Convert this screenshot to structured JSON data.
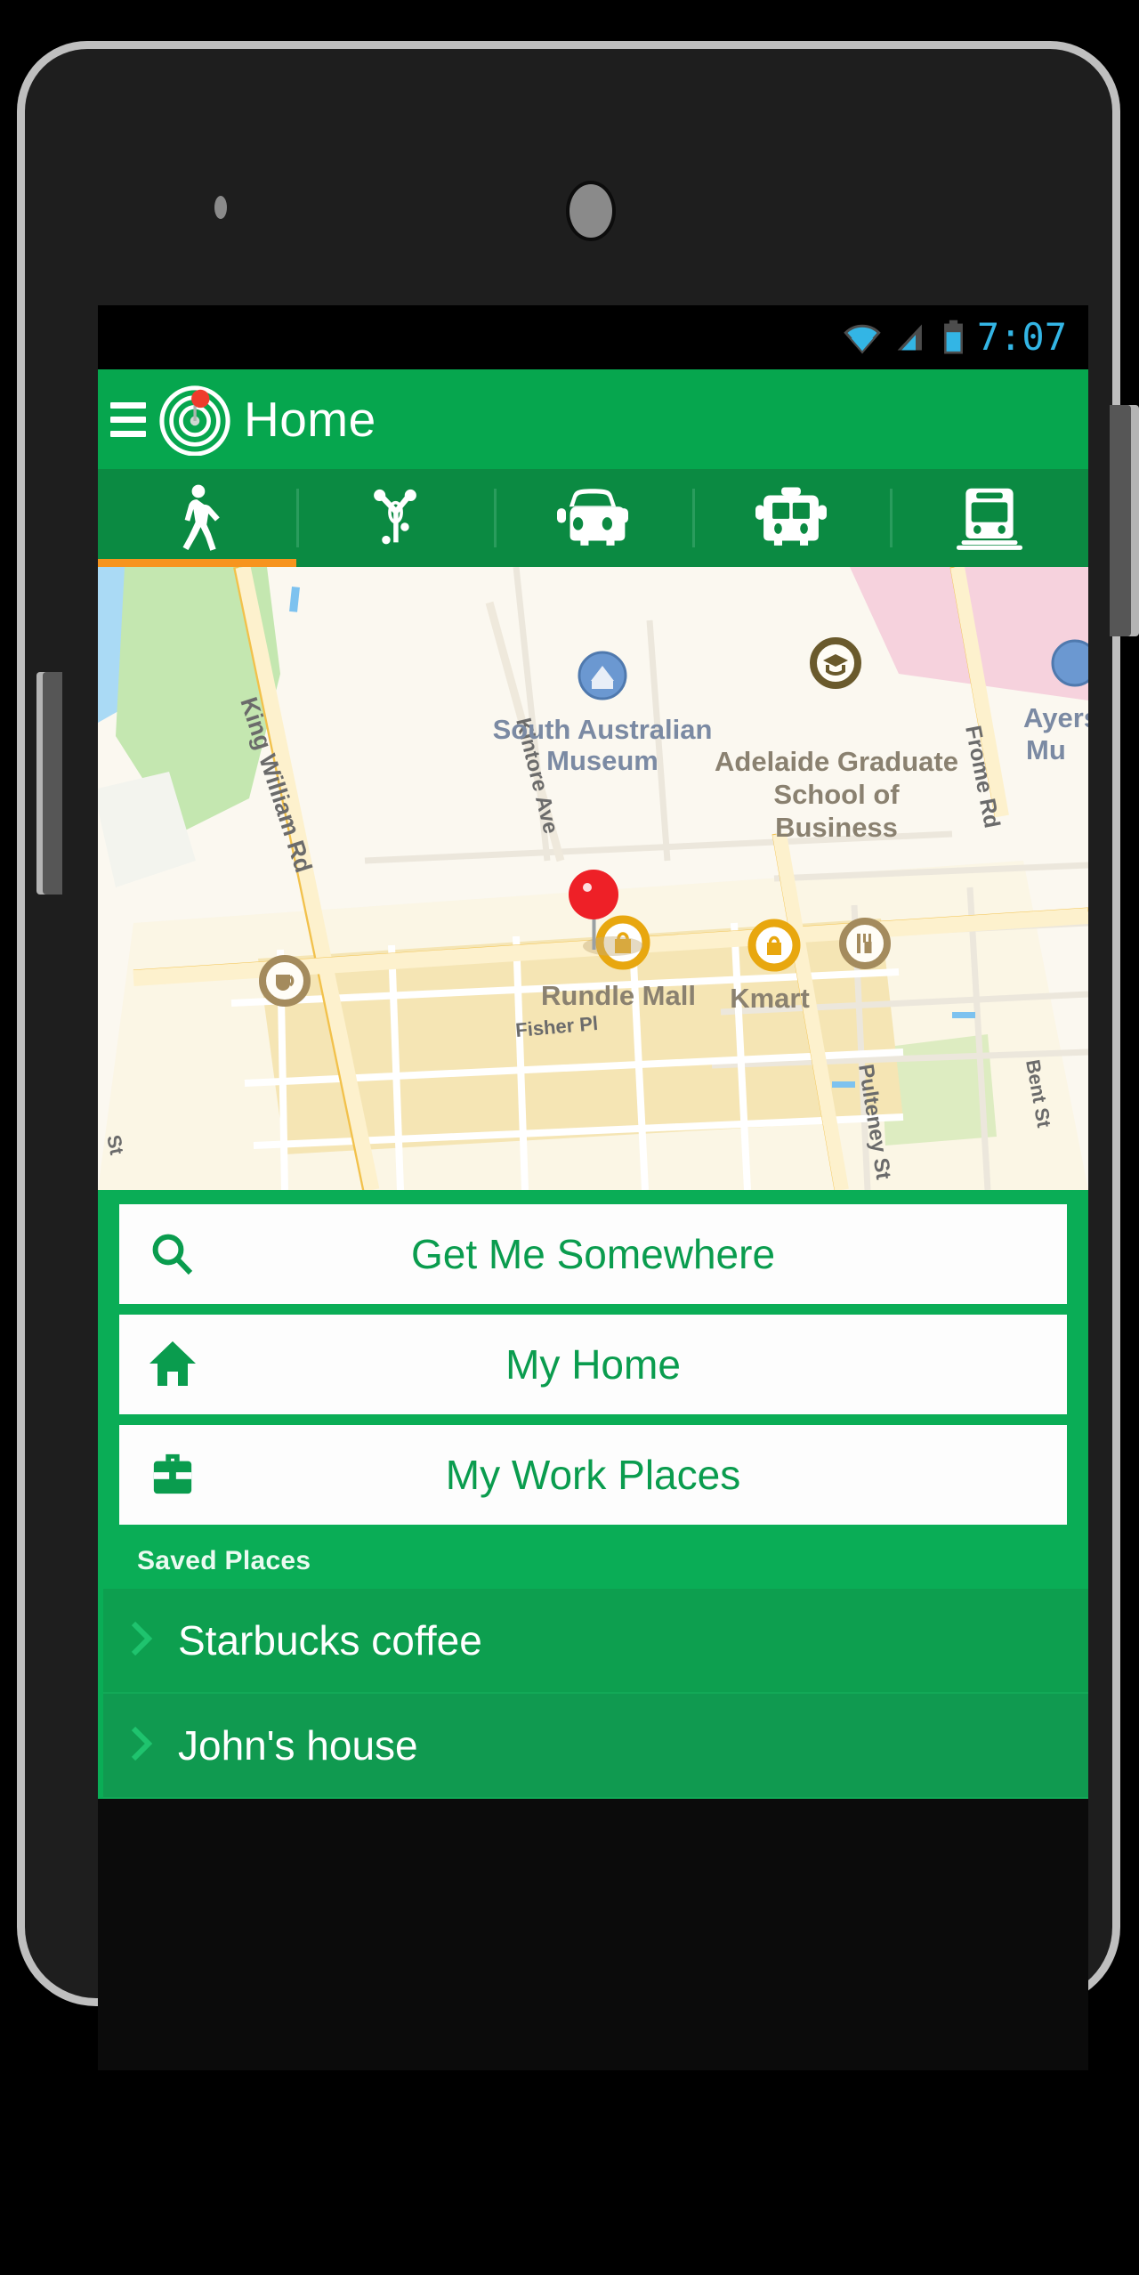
{
  "status_bar": {
    "time": "7:07",
    "icons": [
      "wifi-icon",
      "cellular-signal-icon",
      "battery-icon"
    ],
    "accent_color": "#33b5e5"
  },
  "app_bar": {
    "menu_icon": "hamburger-menu-icon",
    "logo_icon": "target-pin-logo-icon",
    "title": "Home",
    "background_color": "#06a64e"
  },
  "mode_tabs": {
    "selected_index": 0,
    "underline_color": "#f7941e",
    "items": [
      {
        "icon": "walk-icon",
        "label": "Walk"
      },
      {
        "icon": "bicycle-icon",
        "label": "Bike"
      },
      {
        "icon": "car-icon",
        "label": "Car"
      },
      {
        "icon": "bus-icon",
        "label": "Bus"
      },
      {
        "icon": "train-icon",
        "label": "Train"
      }
    ]
  },
  "map": {
    "marker_icon": "red-map-pin",
    "street_labels": [
      "King William Rd",
      "Kintore Ave",
      "Frome Rd",
      "Pulteney St",
      "Bent St",
      "Fisher Pl"
    ],
    "place_labels": [
      "South Australian Museum",
      "Adelaide Graduate School of Business",
      "Rundle Mall",
      "Kmart",
      "Ayers\nMu"
    ],
    "poi_icons": [
      "museum-icon",
      "university-icon",
      "shopping-bag-icon",
      "restaurant-icon",
      "cafe-icon"
    ]
  },
  "actions": [
    {
      "icon": "search-icon",
      "label": "Get Me Somewhere"
    },
    {
      "icon": "home-icon",
      "label": "My Home"
    },
    {
      "icon": "briefcase-icon",
      "label": "My Work Places"
    }
  ],
  "saved_places": {
    "header": "Saved Places",
    "items": [
      {
        "icon": "chevron-right-icon",
        "label": "Starbucks coffee"
      },
      {
        "icon": "chevron-right-icon",
        "label": "John's house"
      }
    ]
  },
  "colors": {
    "brand_green": "#06a64e",
    "panel_green": "#0aad56",
    "tab_bar_green": "#0b8a42",
    "accent_orange": "#f7941e",
    "marker_red": "#ea1c24"
  }
}
